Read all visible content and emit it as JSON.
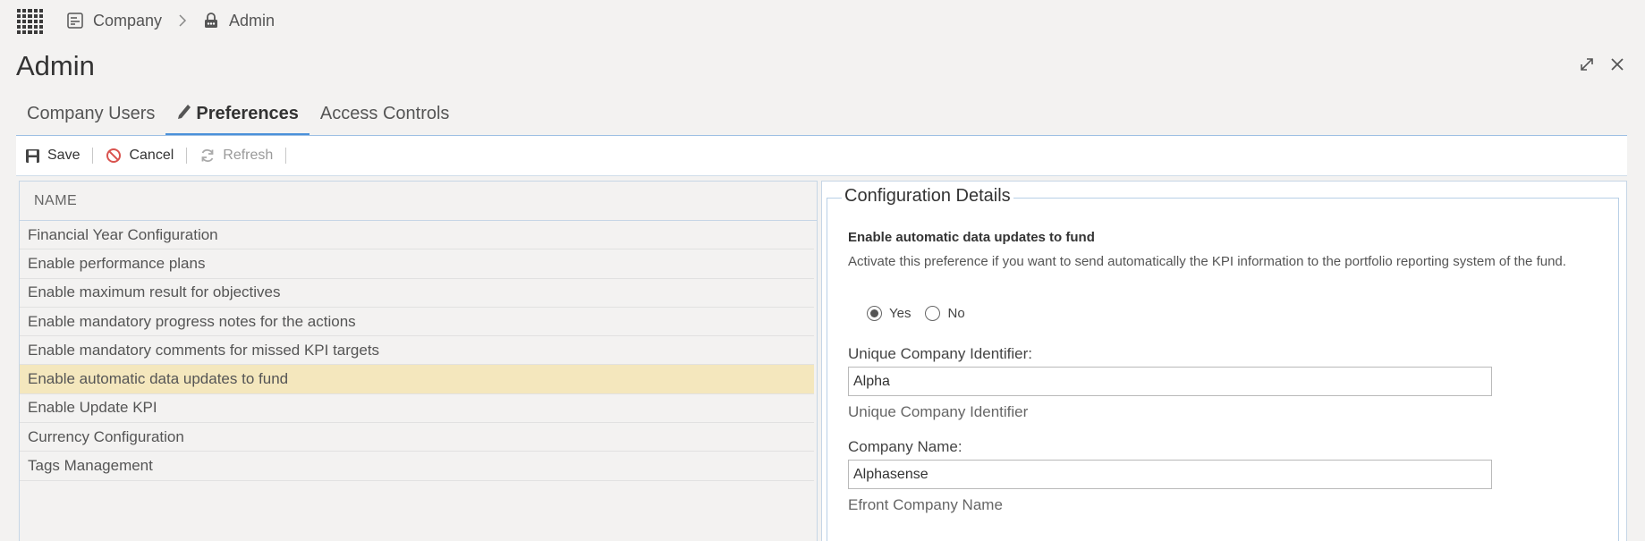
{
  "breadcrumb": {
    "items": [
      "Company",
      "Admin"
    ],
    "separator_icon": "chevron-right-icon"
  },
  "page": {
    "title": "Admin"
  },
  "tabs": [
    {
      "label": "Company Users",
      "active": false
    },
    {
      "label": "Preferences",
      "active": true,
      "icon": "pencil-icon"
    },
    {
      "label": "Access Controls",
      "active": false
    }
  ],
  "toolbar": {
    "save_label": "Save",
    "cancel_label": "Cancel",
    "refresh_label": "Refresh"
  },
  "list": {
    "header": "NAME",
    "items": [
      "Financial Year Configuration",
      "Enable performance plans",
      "Enable maximum result for objectives",
      "Enable mandatory progress notes for the actions",
      "Enable mandatory comments for missed KPI targets",
      "Enable automatic data updates to fund",
      "Enable Update KPI",
      "Currency Configuration",
      "Tags Management"
    ],
    "selected_index": 5
  },
  "config": {
    "legend": "Configuration Details",
    "title": "Enable automatic data updates to fund",
    "description": "Activate this preference if you want to send automatically the KPI information to the portfolio reporting system of the fund.",
    "radio_yes": "Yes",
    "radio_no": "No",
    "selected": "Yes",
    "fields": [
      {
        "label": "Unique Company Identifier:",
        "value": "Alpha",
        "hint": "Unique Company Identifier"
      },
      {
        "label": "Company Name:",
        "value": "Alphasense",
        "hint": "Efront Company Name"
      }
    ]
  },
  "colors": {
    "selected_row": "#f4e7bd",
    "tab_accent": "#4a90d9",
    "panel_border": "#c6d6e6"
  }
}
